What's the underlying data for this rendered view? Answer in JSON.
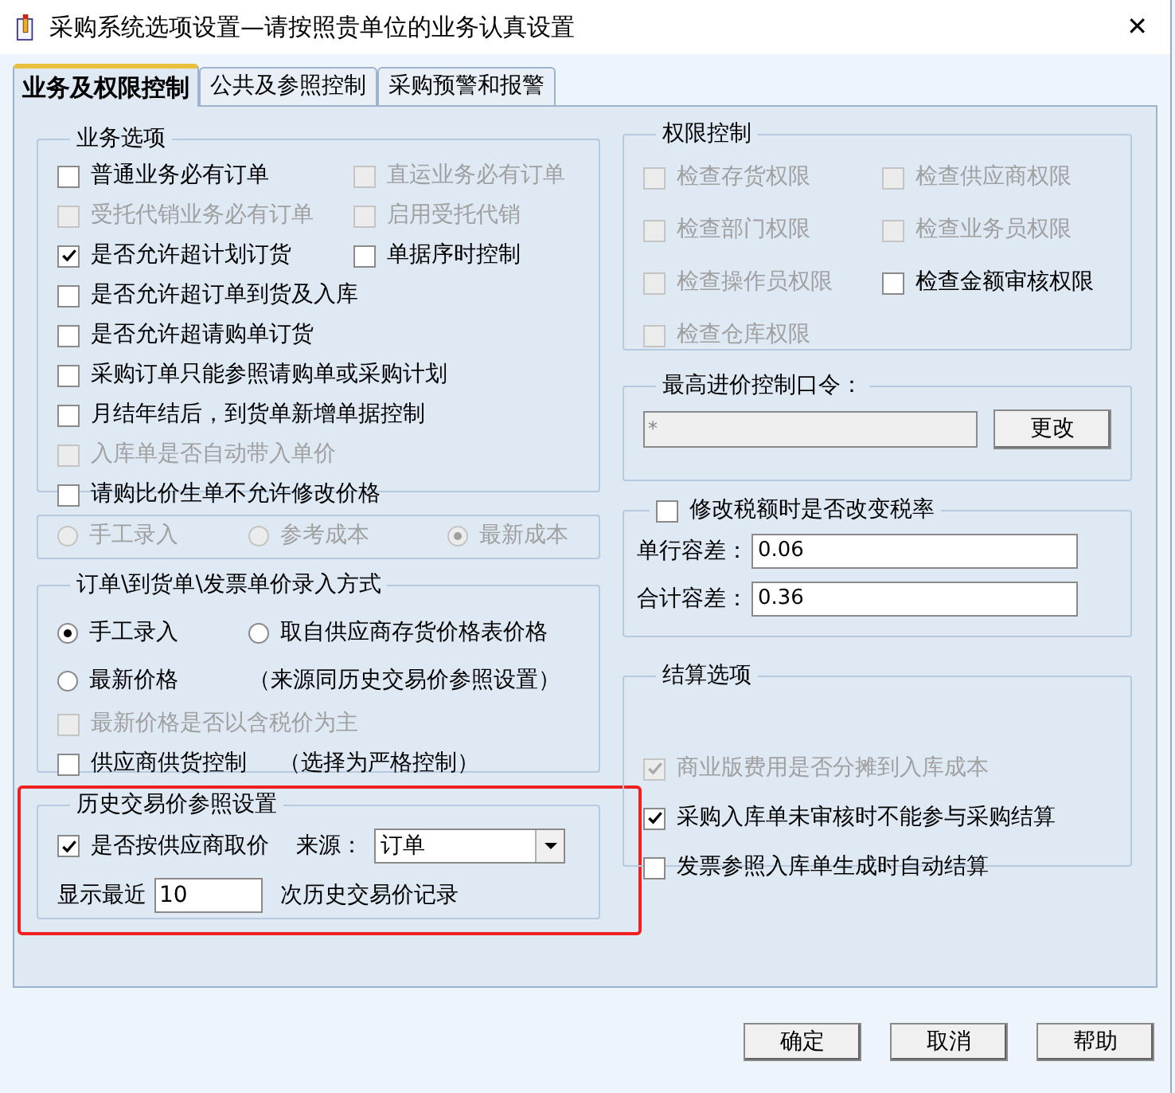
{
  "window": {
    "title": "采购系统选项设置—请按照贵单位的业务认真设置",
    "close": "✕"
  },
  "tabs": [
    {
      "label": "业务及权限控制",
      "selected": true
    },
    {
      "label": "公共及参照控制",
      "selected": false
    },
    {
      "label": "采购预警和报警",
      "selected": false
    }
  ],
  "business_options": {
    "title": "业务选项",
    "rows": [
      [
        {
          "kind": "checkbox",
          "label": "普通业务必有订单",
          "checked": false,
          "disabled": false
        },
        {
          "kind": "checkbox",
          "label": "直运业务必有订单",
          "checked": false,
          "disabled": true
        }
      ],
      [
        {
          "kind": "checkbox",
          "label": "受托代销业务必有订单",
          "checked": false,
          "disabled": true
        },
        {
          "kind": "checkbox",
          "label": "启用受托代销",
          "checked": false,
          "disabled": true
        }
      ],
      [
        {
          "kind": "checkbox",
          "label": "是否允许超计划订货",
          "checked": true,
          "disabled": false
        },
        {
          "kind": "checkbox",
          "label": "单据序时控制",
          "checked": false,
          "disabled": false
        }
      ],
      [
        {
          "kind": "checkbox",
          "label": "是否允许超订单到货及入库",
          "checked": false,
          "disabled": false
        }
      ],
      [
        {
          "kind": "checkbox",
          "label": "是否允许超请购单订货",
          "checked": false,
          "disabled": false
        }
      ],
      [
        {
          "kind": "checkbox",
          "label": "采购订单只能参照请购单或采购计划",
          "checked": false,
          "disabled": false
        }
      ],
      [
        {
          "kind": "checkbox",
          "label": "月结年结后，到货单新增单据控制",
          "checked": false,
          "disabled": false
        }
      ],
      [
        {
          "kind": "checkbox",
          "label": "入库单是否自动带入单价",
          "checked": false,
          "disabled": true
        }
      ],
      [
        {
          "kind": "checkbox",
          "label": "请购比价生单不允许修改价格",
          "checked": false,
          "disabled": false
        }
      ]
    ]
  },
  "cost_source": {
    "rows": [
      [
        {
          "kind": "radio",
          "label": "手工录入",
          "selected": false,
          "disabled": true
        },
        {
          "kind": "radio",
          "label": "参考成本",
          "selected": false,
          "disabled": true
        },
        {
          "kind": "radio",
          "label": "最新成本",
          "selected": true,
          "disabled": true
        }
      ]
    ]
  },
  "price_entry": {
    "title": "订单\\到货单\\发票单价录入方式",
    "rows": [
      [
        {
          "kind": "radio",
          "label": "手工录入",
          "selected": true,
          "disabled": false
        },
        {
          "kind": "radio",
          "label": "取自供应商存货价格表价格",
          "selected": false,
          "disabled": false
        }
      ],
      [
        {
          "kind": "radio",
          "label": "最新价格",
          "selected": false,
          "disabled": false
        },
        {
          "kind": "note",
          "label": "（来源同历史交易价参照设置）"
        }
      ],
      [
        {
          "kind": "checkbox",
          "label": "最新价格是否以含税价为主",
          "checked": false,
          "disabled": true
        }
      ],
      [
        {
          "kind": "checkbox",
          "label": "供应商供货控制",
          "checked": false,
          "disabled": false
        },
        {
          "kind": "note",
          "label": "（选择为严格控制）"
        }
      ]
    ]
  },
  "history_price": {
    "title": "历史交易价参照设置",
    "highlighted": true,
    "by_supplier": {
      "label": "是否按供应商取价",
      "checked": true
    },
    "source_label": "来源：",
    "source_value": "订单",
    "recent_label": "显示最近",
    "recent_value": "10",
    "records_label": "次历史交易价记录"
  },
  "permissions": {
    "title": "权限控制",
    "rows": [
      [
        {
          "kind": "checkbox",
          "label": "检查存货权限",
          "checked": false,
          "disabled": true
        },
        {
          "kind": "checkbox",
          "label": "检查供应商权限",
          "checked": false,
          "disabled": true
        }
      ],
      [
        {
          "kind": "checkbox",
          "label": "检查部门权限",
          "checked": false,
          "disabled": true
        },
        {
          "kind": "checkbox",
          "label": "检查业务员权限",
          "checked": false,
          "disabled": true
        }
      ],
      [
        {
          "kind": "checkbox",
          "label": "检查操作员权限",
          "checked": false,
          "disabled": true
        },
        {
          "kind": "checkbox",
          "label": "检查金额审核权限",
          "checked": false,
          "disabled": false
        }
      ],
      [
        {
          "kind": "checkbox",
          "label": "检查仓库权限",
          "checked": false,
          "disabled": true
        }
      ]
    ]
  },
  "max_price_password": {
    "title": "最高进价控制口令：",
    "value": "*",
    "disabled": true,
    "button": "更改"
  },
  "tax_tolerance": {
    "toggle": {
      "label": "修改税额时是否改变税率",
      "checked": false
    },
    "fields": [
      {
        "label": "单行容差：",
        "value": "0.06"
      },
      {
        "label": "合计容差：",
        "value": "0.36"
      }
    ]
  },
  "settlement": {
    "title": "结算选项",
    "rows": [
      [
        {
          "kind": "checkbox",
          "label": "商业版费用是否分摊到入库成本",
          "checked": true,
          "disabled": true
        }
      ],
      [
        {
          "kind": "checkbox",
          "label": "采购入库单未审核时不能参与采购结算",
          "checked": true,
          "disabled": false
        }
      ],
      [
        {
          "kind": "checkbox",
          "label": "发票参照入库单生成时自动结算",
          "checked": false,
          "disabled": false
        }
      ]
    ]
  },
  "buttons": [
    "确定",
    "取消",
    "帮助"
  ]
}
